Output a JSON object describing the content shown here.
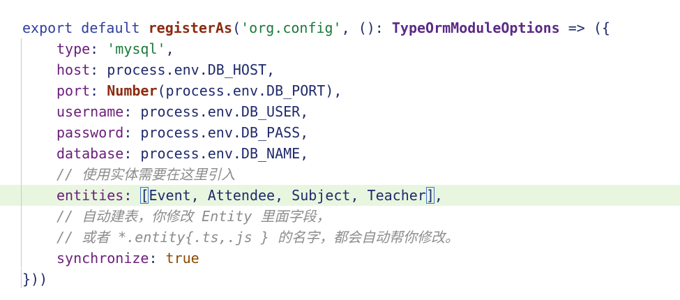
{
  "code": {
    "line1": {
      "export": "export",
      "default": "default",
      "fn": "registerAs",
      "open": "(",
      "arg": "'org.config'",
      "mid": ", (): ",
      "type": "TypeOrmModuleOptions",
      "tail": " => ({"
    },
    "type_line": {
      "key": "type",
      "sep": ": ",
      "value": "'mysql'",
      "end": ","
    },
    "host_line": {
      "key": "host",
      "sep": ": ",
      "value": "process.env.DB_HOST",
      "end": ","
    },
    "port_line": {
      "key": "port",
      "sep": ": ",
      "fn": "Number",
      "value": "(process.env.DB_PORT)",
      "end": ","
    },
    "username_line": {
      "key": "username",
      "sep": ": ",
      "value": "process.env.DB_USER",
      "end": ","
    },
    "password_line": {
      "key": "password",
      "sep": ": ",
      "value": "process.env.DB_PASS",
      "end": ","
    },
    "database_line": {
      "key": "database",
      "sep": ": ",
      "value": "process.env.DB_NAME",
      "end": ","
    },
    "comment1": "// 使用实体需要在这里引入",
    "entities_line": {
      "key": "entities",
      "sep": ": ",
      "open": "[",
      "items": "Event, Attendee, Subject, Teacher",
      "close": "]",
      "end": ","
    },
    "comment2": "// 自动建表，你修改 Entity 里面字段，",
    "comment3": "// 或者 *.entity{.ts,.js } 的名字，都会自动帮你修改。",
    "sync_line": {
      "key": "synchronize",
      "sep": ": ",
      "value": "true"
    },
    "closing": "}))"
  }
}
